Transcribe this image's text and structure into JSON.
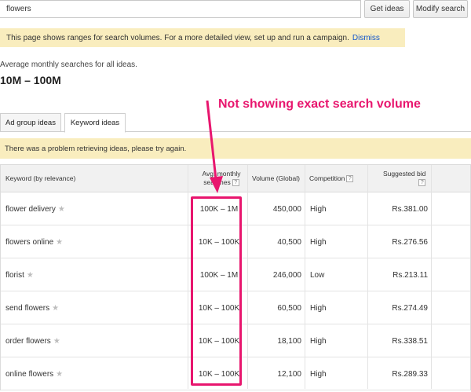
{
  "search": {
    "value": "flowers"
  },
  "buttons": {
    "get_ideas": "Get ideas",
    "modify_search": "Modify search"
  },
  "notice": {
    "text": "This page shows ranges for search volumes. For a more detailed view, set up and run a campaign.",
    "dismiss": "Dismiss"
  },
  "summary": {
    "label": "Average monthly searches for all ideas.",
    "value": "10M – 100M"
  },
  "tabs": [
    {
      "label": "Ad group ideas",
      "active": false
    },
    {
      "label": "Keyword ideas",
      "active": true
    }
  ],
  "error": {
    "text": "There was a problem retrieving ideas, please try again."
  },
  "table": {
    "headers": {
      "keyword": "Keyword (by relevance)",
      "avg_line1": "Avg. monthly",
      "avg_line2": "searches",
      "volume": "Volume (Global)",
      "competition": "Competition",
      "bid_line1": "Suggested bid"
    },
    "rows": [
      {
        "keyword": "flower delivery",
        "avg": "100K – 1M",
        "volume": "450,000",
        "competition": "High",
        "bid": "Rs.381.00"
      },
      {
        "keyword": "flowers online",
        "avg": "10K – 100K",
        "volume": "40,500",
        "competition": "High",
        "bid": "Rs.276.56"
      },
      {
        "keyword": "florist",
        "avg": "100K – 1M",
        "volume": "246,000",
        "competition": "Low",
        "bid": "Rs.213.11"
      },
      {
        "keyword": "send flowers",
        "avg": "10K – 100K",
        "volume": "60,500",
        "competition": "High",
        "bid": "Rs.274.49"
      },
      {
        "keyword": "order flowers",
        "avg": "10K – 100K",
        "volume": "18,100",
        "competition": "High",
        "bid": "Rs.338.51"
      },
      {
        "keyword": "online flowers",
        "avg": "10K – 100K",
        "volume": "12,100",
        "competition": "High",
        "bid": "Rs.289.33"
      }
    ]
  },
  "annotation": {
    "text": "Not showing exact search volume",
    "color": "#e8166e"
  },
  "icons": {
    "star": "star-icon",
    "help": "help-icon"
  }
}
